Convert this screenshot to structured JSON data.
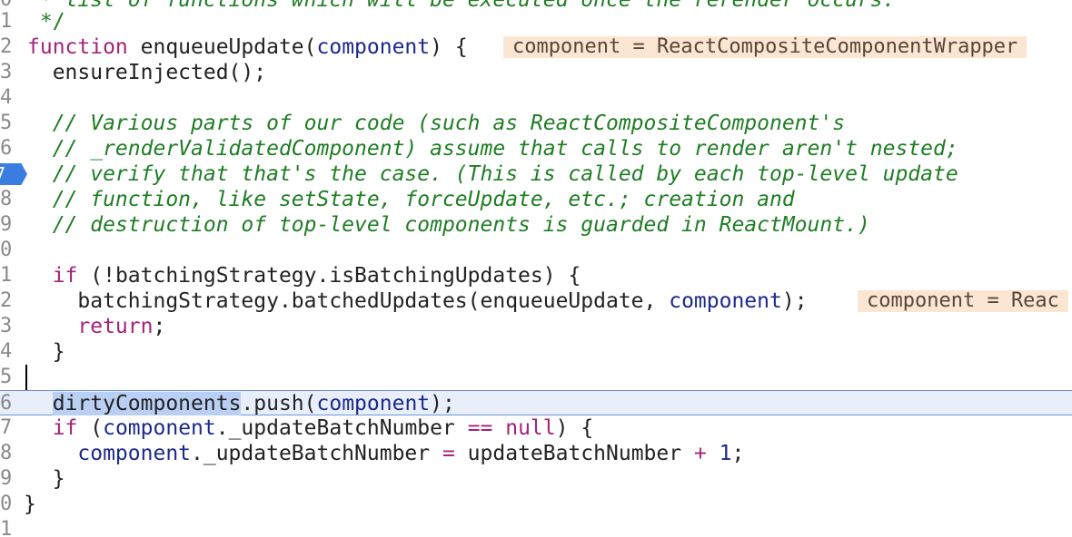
{
  "editor": {
    "lines": [
      {
        "num": "0",
        "code": " * list of functions which will be executed once the rerender occurs."
      },
      {
        "num": "1",
        "code": " */"
      },
      {
        "num": "2",
        "pre": "",
        "kw": "function",
        "rest": " enqueueUpdate(",
        "param": "component",
        "rest2": ") {",
        "inline": "component = ReactCompositeComponentWrapper"
      },
      {
        "num": "3",
        "code": "  ensureInjected();"
      },
      {
        "num": "4",
        "code": ""
      },
      {
        "num": "5",
        "comment": "  // Various parts of our code (such as ReactCompositeComponent's"
      },
      {
        "num": "6",
        "comment": "  // _renderValidatedComponent) assume that calls to render aren't nested;"
      },
      {
        "num": "7",
        "comment": "  // verify that that's the case. (This is called by each top-level update"
      },
      {
        "num": "8",
        "comment": "  // function, like setState, forceUpdate, etc.; creation and"
      },
      {
        "num": "9",
        "comment": "  // destruction of top-level components is guarded in ReactMount.)"
      },
      {
        "num": "0",
        "code": ""
      },
      {
        "num": "1",
        "kwline": {
          "indent": "  ",
          "kw": "if",
          "rest": " (!batchingStrategy.isBatchingUpdates) {"
        }
      },
      {
        "num": "2",
        "code": "    batchingStrategy.batchedUpdates(enqueueUpdate, ",
        "param": "component",
        "rest2": ");",
        "inline": "component = Reac"
      },
      {
        "num": "3",
        "kwline": {
          "indent": "    ",
          "kw": "return",
          "rest": ";"
        }
      },
      {
        "num": "4",
        "code": "  }"
      },
      {
        "num": "5",
        "code": ""
      },
      {
        "num": "6",
        "sel": "dirtyComponents",
        "code": ".push(",
        "param": "component",
        "rest2": ");"
      },
      {
        "num": "7",
        "kwline": {
          "indent": "  ",
          "kw": "if",
          "rest": " ("
        },
        "param": "component",
        "rest2": "._updateBatchNumber ",
        "op": "==",
        "kw2": " null",
        "rest3": ") {"
      },
      {
        "num": "8",
        "param": "component",
        "rest2": "._updateBatchNumber ",
        "op": "=",
        "rest3": " updateBatchNumber ",
        "op2": "+",
        "num2": " 1",
        "rest4": ";"
      },
      {
        "num": "9",
        "code": "  }"
      },
      {
        "num": "0",
        "code": "}"
      },
      {
        "num": "1",
        "code": ""
      }
    ],
    "breakpoint_line": "7"
  }
}
